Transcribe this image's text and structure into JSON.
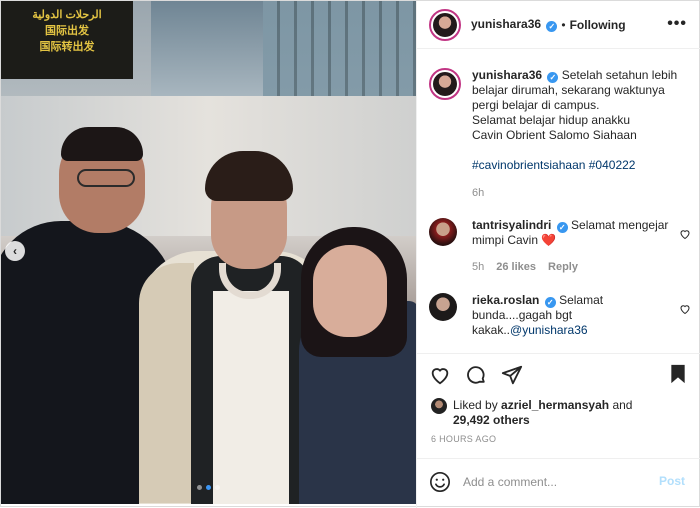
{
  "photo": {
    "sign_lines": [
      "الرحلات الدولية",
      "国际出发",
      "国际转出发"
    ],
    "carousel_prev": "‹",
    "slide_count": 3,
    "active_slide": 2
  },
  "header": {
    "username": "yunishara36",
    "separator": "•",
    "follow_label": "Following",
    "more_label": "•••"
  },
  "caption": {
    "username": "yunishara36",
    "lines": [
      "Setelah setahun lebih belajar dirumah, sekarang waktunya pergi belajar di campus.",
      "Selamat belajar hidup anakku",
      "Cavin Obrient Salomo Siahaan",
      "#cavinobrientsiahaan #040222"
    ],
    "time": "6h"
  },
  "comments": [
    {
      "username": "tantrisyalindri",
      "text": "Selamat mengejar mimpi Cavin",
      "emoji": "❤️",
      "time": "5h",
      "likes": "26 likes",
      "reply": "Reply"
    },
    {
      "username": "rieka.roslan",
      "text": "Selamat bunda....gagah bgt kakak..",
      "mention": "@yunishara36"
    }
  ],
  "likes": {
    "prefix": "Liked by",
    "by_user": "azriel_hermansyah",
    "and": "and",
    "others": "29,492 others"
  },
  "timestamp": "6 HOURS AGO",
  "add_comment": {
    "placeholder": "Add a comment...",
    "post_label": "Post"
  },
  "colors": {
    "verified": "#3897f0",
    "link": "#00376b",
    "post_disabled": "#b2dffc",
    "like_red": "#ed4956"
  }
}
